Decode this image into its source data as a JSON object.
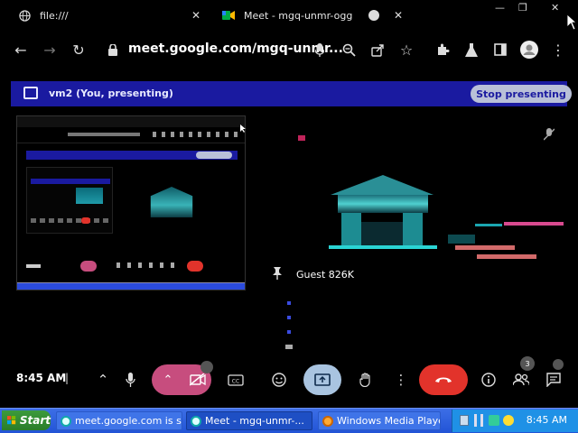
{
  "tabs": [
    {
      "label": "file:///",
      "icon": "globe-icon"
    },
    {
      "label": "Meet - mgq-unmr-ogg",
      "icon": "meet-icon"
    }
  ],
  "browser": {
    "url": "meet.google.com/mgq-unmr..."
  },
  "presenting": {
    "label": "vm2 (You, presenting)",
    "stop_label": "Stop presenting"
  },
  "participant": {
    "name": "Guest 826K"
  },
  "meeting": {
    "time": "8:45 AM",
    "separator": "|",
    "people_badge": "3"
  },
  "taskbar": {
    "start_label": "Start",
    "items": [
      {
        "label": "meet.google.com is s..."
      },
      {
        "label": "Meet - mgq-unmr-..."
      },
      {
        "label": "Windows Media Player"
      }
    ],
    "clock": "8:45 AM"
  },
  "colors": {
    "present_bar": "#1a1aa0",
    "stop_button": "#b9c0d8",
    "end_call": "#e2332b",
    "camera_off": "#c74d7e",
    "taskbar": "#2254d6"
  }
}
